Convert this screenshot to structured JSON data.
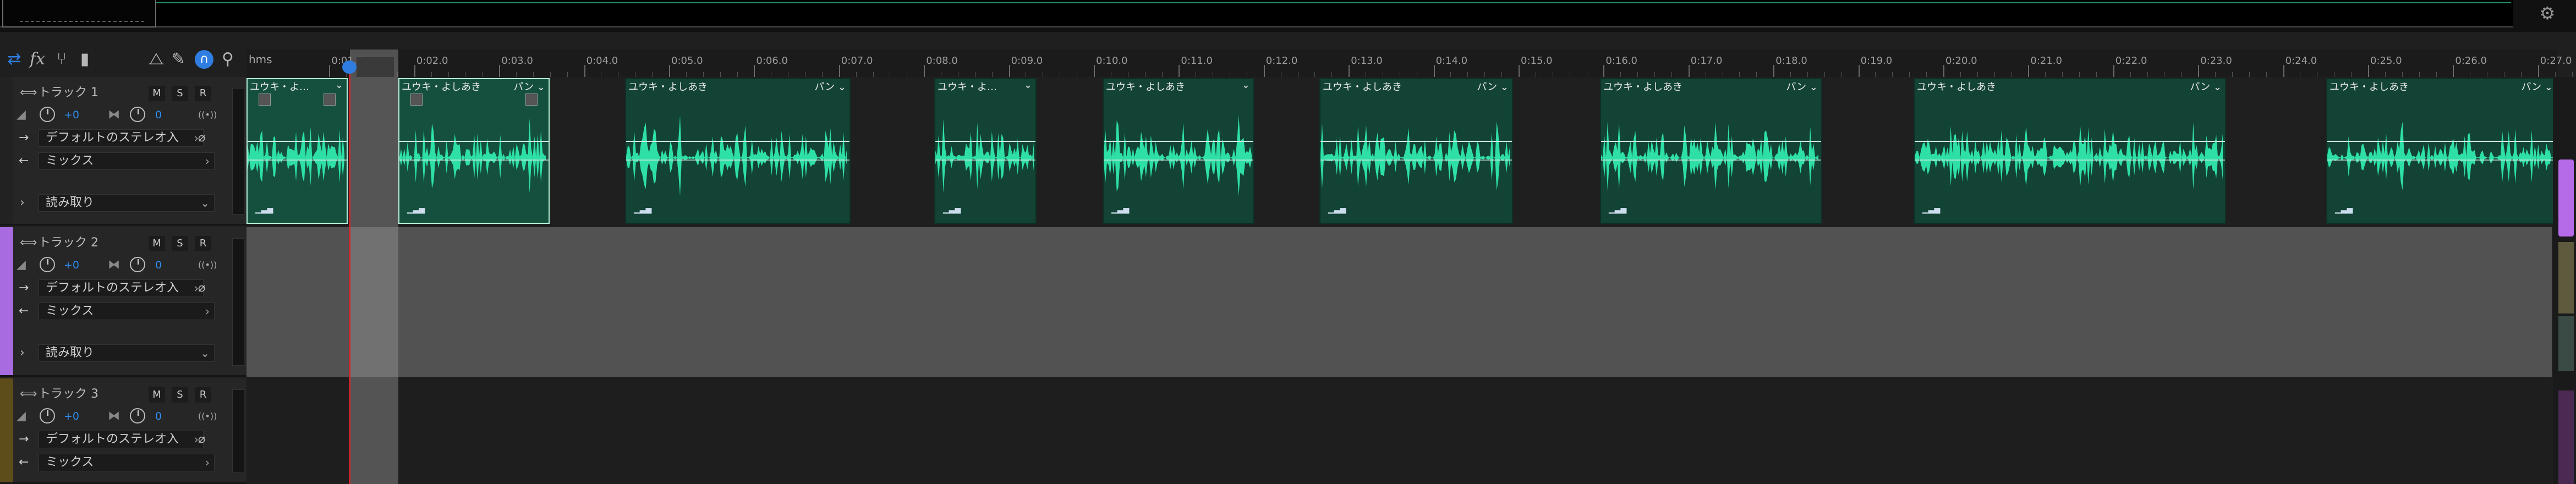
{
  "ruler": {
    "unit_label": "hms",
    "ticks": [
      "0:01.0",
      "0:02.0",
      "0:03.0",
      "0:04.0",
      "0:05.0",
      "0:06.0",
      "0:07.0",
      "0:08.0",
      "0:09.0",
      "0:10.0",
      "0:11.0",
      "0:12.0",
      "0:13.0",
      "0:14.0",
      "0:15.0",
      "0:16.0",
      "0:17.0",
      "0:18.0",
      "0:19.0",
      "0:20.0",
      "0:21.0",
      "0:22.0",
      "0:23.0",
      "0:24.0",
      "0:25.0",
      "0:26.0",
      "0:27.0"
    ]
  },
  "tracks": [
    {
      "name": "トラック 1",
      "volume": "+0",
      "pan": "0",
      "output": "デフォルトのステレオ入",
      "input": "ミックス",
      "automation": "読み取り",
      "buttons": [
        "M",
        "S",
        "R"
      ],
      "color": "#222222"
    },
    {
      "name": "トラック 2",
      "volume": "+0",
      "pan": "0",
      "output": "デフォルトのステレオ入",
      "input": "ミックス",
      "automation": "読み取り",
      "buttons": [
        "M",
        "S",
        "R"
      ],
      "color": "#a86be0"
    },
    {
      "name": "トラック 3",
      "volume": "+0",
      "pan": "0",
      "output": "デフォルトのステレオ入",
      "input": "ミックス",
      "buttons": [
        "M",
        "S",
        "R"
      ],
      "color": "#5c4d1a"
    }
  ],
  "clips": [
    {
      "title": "ユウキ・よ…",
      "menu": "⌄",
      "selected": true
    },
    {
      "title": "ユウキ・よしあき",
      "menu": "パン ⌄",
      "selected": true
    },
    {
      "title": "ユウキ・よしあき",
      "menu": "パン ⌄",
      "selected": false
    },
    {
      "title": "ユウキ・よ…",
      "menu": "⌄",
      "selected": false
    },
    {
      "title": "ユウキ・よしあき",
      "menu": "⌄",
      "selected": false
    },
    {
      "title": "ユウキ・よしあき",
      "menu": "パン ⌄",
      "selected": false
    },
    {
      "title": "ユウキ・よしあき",
      "menu": "パン ⌄",
      "selected": false
    },
    {
      "title": "ユウキ・よしあき",
      "menu": "パン ⌄",
      "selected": false
    },
    {
      "title": "ユウキ・よしあき",
      "menu": "パン ⌄",
      "selected": false
    }
  ],
  "toolbar_icons": [
    "loop-icon",
    "fx-icon",
    "branch-icon",
    "meter-icon",
    "metronome-icon",
    "pencil-icon",
    "snap-icon",
    "marker-icon"
  ],
  "colors": {
    "clip": "#134335",
    "waveform": "#2ee0a6",
    "playhead": "#d1242b",
    "accent": "#2f7de1"
  }
}
